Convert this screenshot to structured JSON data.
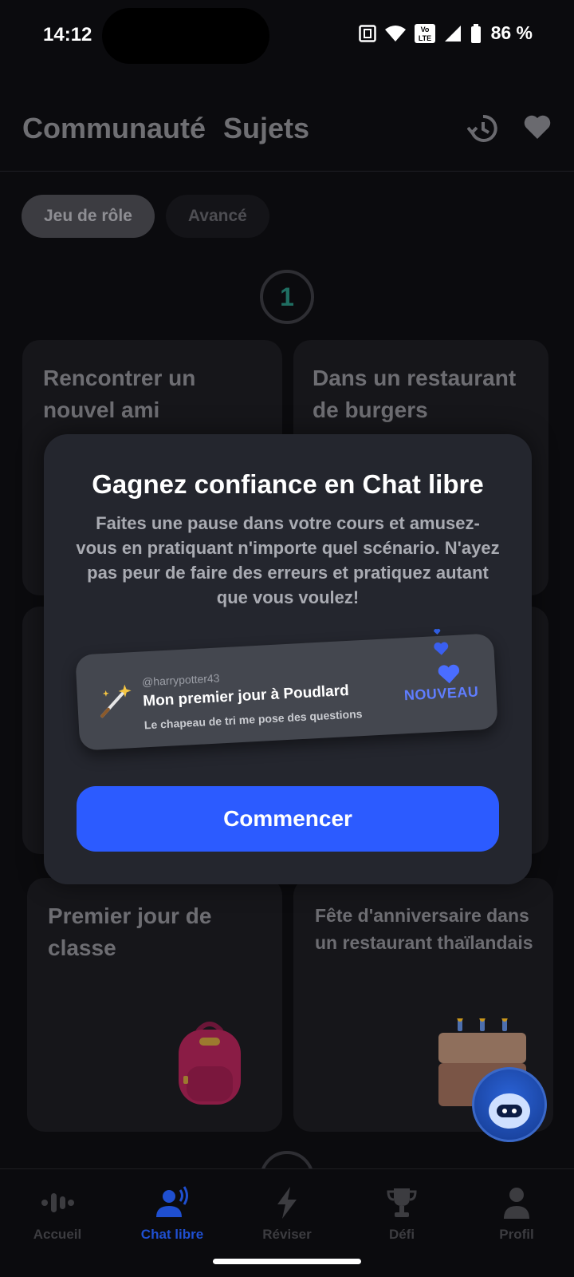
{
  "status_bar": {
    "time": "14:12",
    "battery": "86 %",
    "volte_label": "Vo LTE"
  },
  "header": {
    "tabs": [
      "Communauté",
      "Sujets"
    ],
    "icons": [
      "history-icon",
      "heart-icon"
    ]
  },
  "filters": {
    "chips": [
      "Jeu de rôle",
      "Avancé"
    ]
  },
  "step": {
    "number": "1"
  },
  "cards": [
    {
      "title": "Rencontrer un nouvel ami"
    },
    {
      "title": "Dans un restaurant de burgers"
    },
    {
      "title": "Premier jour de classe"
    },
    {
      "title": "Fête d'anniversaire dans un restaurant thaïlandais"
    }
  ],
  "modal": {
    "title": "Gagnez confiance en Chat libre",
    "body": "Faites une pause dans votre cours et amusez-vous en pratiquant n'importe quel scénario. N'ayez pas peur de faire des erreurs et pratiquez autant que vous voulez!",
    "scenario": {
      "user": "@harrypotter43",
      "title": "Mon premier jour à Poudlard",
      "subtitle": "Le chapeau de tri me pose des questions",
      "badge": "NOUVEAU"
    },
    "button": "Commencer"
  },
  "bottom_nav": {
    "items": [
      {
        "label": "Accueil",
        "icon": "audio-wave-icon",
        "active": false
      },
      {
        "label": "Chat libre",
        "icon": "speaking-person-icon",
        "active": true
      },
      {
        "label": "Réviser",
        "icon": "lightning-icon",
        "active": false
      },
      {
        "label": "Défi",
        "icon": "trophy-icon",
        "active": false
      },
      {
        "label": "Profil",
        "icon": "person-icon",
        "active": false
      }
    ]
  },
  "colors": {
    "accent": "#2c5bff",
    "modal_bg": "#24262e",
    "badge": "#5f7dff"
  }
}
